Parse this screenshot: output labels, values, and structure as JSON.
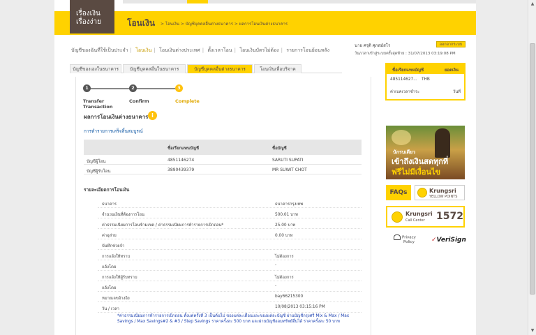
{
  "logo": {
    "line1": "เรื่องเงิน",
    "line2": "เรื่องง่าย"
  },
  "banner": {
    "title": "โอนเงิน",
    "breadcrumb": "> โอนเงิน > บัญชีบุคคลอื่นต่างธนาคาร > ผลการโอนเงินต่างธนาคาร"
  },
  "main_nav": [
    "บัญชีของฉันที่ใช้เป็นประจำ",
    "โอนเงิน",
    "โอนเงินต่างประเทศ",
    "ตั้งเวลาโอน",
    "โอนเงินบัตรไม่ต้อง",
    "รายการโอนย้อนหลัง"
  ],
  "main_nav_active_index": 1,
  "user": {
    "name": "นาย ศรุติ ศุภสมัสโร",
    "logout_label": "ออกจากระบบ",
    "last_login": "วัน/เวลาเข้าสู่ระบบครั้งสุดท้าย : 31/07/2013 03:19:08 PM"
  },
  "sub_tabs": [
    "บัญชีของเองในธนาคาร",
    "บัญชีบุคคลอื่นในธนาคาร",
    "บัญชีบุคคลอื่นต่างธนาคาร",
    "โอนเงินเพื่อบริจาค"
  ],
  "sub_tab_active_index": 2,
  "steps": [
    {
      "number": "1",
      "label": "Transfer Transaction"
    },
    {
      "number": "2",
      "label": "Confirm"
    },
    {
      "number": "3",
      "label": "Complete"
    }
  ],
  "section_title": "ผลการโอนเงินต่างธนาคาร",
  "info_icon_glyph": "i",
  "success_text": "การทำรายการเสร็จสิ้นสมบูรณ์",
  "accounts": {
    "headers": [
      "",
      "ชื่อเรียกแทนบัญชี",
      "ชื่อบัญชี"
    ],
    "rows": [
      {
        "label": "บัญชีผู้โอน",
        "nickname": "4851146274",
        "name": "SARUTI SUPATI"
      },
      {
        "label": "บัญชีผู้รับโอน",
        "nickname": "3890439379",
        "name": "MR SUWIT CHOT"
      }
    ]
  },
  "details_title": "รายละเอียดการโอนเงิน",
  "details": [
    {
      "label": "ธนาคาร",
      "value": "ธนาคารกรุงเทพ"
    },
    {
      "label": "จำนวนเงินที่ต้องการโอน",
      "value": "500.01 บาท"
    },
    {
      "label": "ค่าธรรมเนียมการโอนข้ามเขต / ค่าธรรมเนียมการทำรายการเบิกถอน*",
      "value": "25.00 บาท"
    },
    {
      "label": "ค่าอุส่าย",
      "value": "0.00 บาท"
    },
    {
      "label": "บันทึกช่วยจำ",
      "value": ""
    },
    {
      "label": "การแจ้งให้ทราบ",
      "value": "ไม่ต้องการ"
    },
    {
      "label": "แจ้งโดย",
      "value": "-"
    },
    {
      "label": "การแจ้งให้ผู้รับทราบ",
      "value": "ไม่ต้องการ"
    },
    {
      "label": "แจ้งโดย",
      "value": "-"
    },
    {
      "label": "หมายเลขอ้างอิง",
      "value": "bay66215300"
    },
    {
      "label": "วัน / เวลา",
      "value": "10/08/2013 03:15:16 PM"
    }
  ],
  "note": "*ค่าธรรมเนียมการทำรายการเบิกถอน ตั้งแต่ครั้งที่ 3 เป็นต้นไป ของแต่ละเดือนและของแต่ละบัญชี ผ่านบัญชีกรุงศรี Mix & Max / Max Savings / Max Savings#2 & #3 / Step Savings ราคาครั้งละ 500 บาท และผ่านบัญชีออมทรัพย์อื่นได้ ราคาครั้งละ 50 บาท",
  "sidebox": {
    "header_left": "ชื่อเรียกแทนบัญชี",
    "header_right": "ยอดเงิน",
    "account": "485114627...",
    "currency": "THB",
    "label2": "ค่าเบคเวลาชำระ",
    "value2": "วันที่"
  },
  "ad": {
    "line1": "นักรบเดียว",
    "line2": "เข้าถึงเงินสดทุกที่",
    "line3": "ฟรีไม่มีเงื่อนไข"
  },
  "faq_label": "FAQs",
  "yellow_points": {
    "name": "Krungsri",
    "sub": "YELLOW POINTS"
  },
  "call_center": {
    "name": "Krungsri",
    "sub": "Call Center",
    "number": "1572"
  },
  "privacy": {
    "line1": "Privacy",
    "line2": "Policy"
  },
  "verisign_label": "VeriSign",
  "colors": {
    "brand_yellow": "#ffd200",
    "brand_brown": "#5a4a42",
    "link_blue": "#1a5fa8"
  }
}
